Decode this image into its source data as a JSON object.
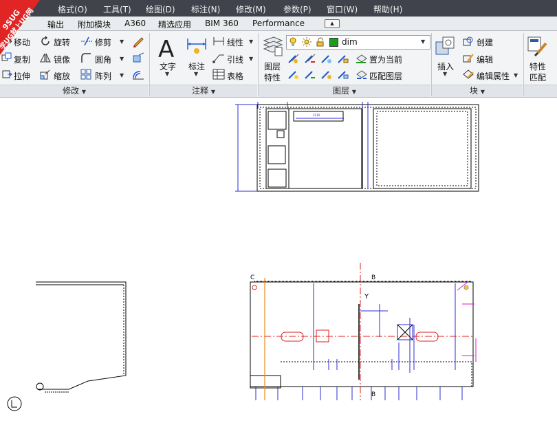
{
  "app": {
    "menu": [
      "格式(O)",
      "工具(T)",
      "绘图(D)",
      "标注(N)",
      "修改(M)",
      "参数(P)",
      "窗口(W)",
      "帮助(H)"
    ],
    "tabs": [
      "输出",
      "附加模块",
      "A360",
      "精选应用",
      "BIM 360",
      "Performance"
    ]
  },
  "watermark": {
    "line1": "9SUG",
    "line2": "学UG就上UG网"
  },
  "ribbon": {
    "modify": {
      "title": "修改",
      "move": "移动",
      "rotate": "旋转",
      "trim": "修剪",
      "copy": "复制",
      "mirror": "镜像",
      "fillet": "圆角",
      "stretch": "拉伸",
      "scale": "缩放",
      "array": "阵列"
    },
    "annotation": {
      "title": "注释",
      "text": "文字",
      "dimension": "标注",
      "linear": "线性",
      "leader": "引线",
      "table": "表格"
    },
    "layers": {
      "title": "图层",
      "properties_line1": "图层",
      "properties_line2": "特性",
      "current_layer": "dim",
      "set_current": "置为当前",
      "match_layer": "匹配图层",
      "layer_color": "#1a9e1a"
    },
    "block": {
      "title": "块",
      "insert": "插入",
      "create": "创建",
      "edit": "编辑",
      "edit_attributes": "编辑属性"
    },
    "properties": {
      "line1": "特性",
      "line2": "匹配"
    }
  },
  "drawing": {
    "labels": {
      "c_marker": "C",
      "b_top": "B",
      "b_bottom": "B",
      "axis_y": "Y"
    },
    "colors": {
      "dimension": "#2b2bd6",
      "centerline": "#e0201e",
      "magenta": "#d81ad8",
      "orange": "#f08a1a",
      "outline": "#000000"
    }
  }
}
